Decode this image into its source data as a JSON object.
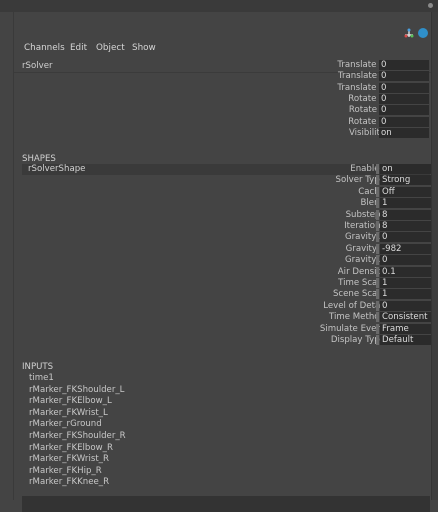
{
  "menu": [
    "Channels",
    "Edit",
    "Object",
    "Show"
  ],
  "node_name": "rSolver",
  "transform_attrs": [
    {
      "label": "Translate X",
      "value": "0"
    },
    {
      "label": "Translate Y",
      "value": "0"
    },
    {
      "label": "Translate Z",
      "value": "0"
    },
    {
      "label": "Rotate X",
      "value": "0"
    },
    {
      "label": "Rotate Y",
      "value": "0"
    },
    {
      "label": "Rotate Z",
      "value": "0"
    },
    {
      "label": "Visibility",
      "value": "on"
    }
  ],
  "shapes_title": "SHAPES",
  "shape_name": "rSolverShape",
  "shape_attrs": [
    {
      "label": "Enabled",
      "value": "on"
    },
    {
      "label": "Solver Type",
      "value": "Strong"
    },
    {
      "label": "Cache",
      "value": "Off"
    },
    {
      "label": "Blend",
      "value": "1"
    },
    {
      "label": "Substeps",
      "value": "8"
    },
    {
      "label": "Iterations",
      "value": "8"
    },
    {
      "label": "Gravity X",
      "value": "0"
    },
    {
      "label": "Gravity Y",
      "value": "-982"
    },
    {
      "label": "Gravity Z",
      "value": "0"
    },
    {
      "label": "Air Density",
      "value": "0.1"
    },
    {
      "label": "Time Scale",
      "value": "1"
    },
    {
      "label": "Scene Scale",
      "value": "1"
    },
    {
      "label": "Level of Detail",
      "value": "0"
    },
    {
      "label": "Time Method",
      "value": "Consistent"
    },
    {
      "label": "Simulate Every",
      "value": "Frame"
    },
    {
      "label": "Display Type",
      "value": "Default"
    }
  ],
  "inputs_title": "INPUTS",
  "inputs": [
    "time1",
    "rMarker_FKShoulder_L",
    "rMarker_FKElbow_L",
    "rMarker_FKWrist_L",
    "rMarker_rGround",
    "rMarker_FKShoulder_R",
    "rMarker_FKElbow_R",
    "rMarker_FKWrist_R",
    "rMarker_FKHip_R",
    "rMarker_FKKnee_R"
  ]
}
